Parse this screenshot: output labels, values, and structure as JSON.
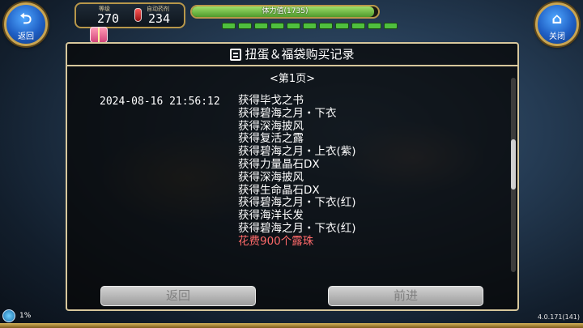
{
  "hud": {
    "back_button": "返回",
    "close_button": "关闭",
    "level_label": "等级",
    "level_value": "270",
    "potion_label": "自动药剂",
    "potion_value": "234",
    "stamina_label": "体力值(1735)",
    "stamina_fraction": 0.98,
    "stamina_segments": 11
  },
  "dialog": {
    "title": "扭蛋＆福袋购买记录",
    "page_label": "<第1页>",
    "record": {
      "timestamp": "2024-08-16 21:56:12",
      "items": [
        "获得毕戈之书",
        "获得碧海之月・下衣",
        "获得深海披风",
        "获得复活之露",
        "获得碧海之月・上衣(紫)",
        "获得力量晶石DX",
        "获得深海披风",
        "获得生命晶石DX",
        "获得碧海之月・下衣(红)",
        "获得海洋长发",
        "获得碧海之月・下衣(红)"
      ],
      "cost": "花费900个露珠"
    },
    "back_button": "返回",
    "forward_button": "前进"
  },
  "status": {
    "battery": "1%",
    "version": "4.0.171(141)"
  },
  "colors": {
    "frame_gold": "#b8974a",
    "dialog_border": "#d7c79c",
    "cost_text": "#ff6a6a",
    "stamina_green": "#4fbf3e"
  }
}
